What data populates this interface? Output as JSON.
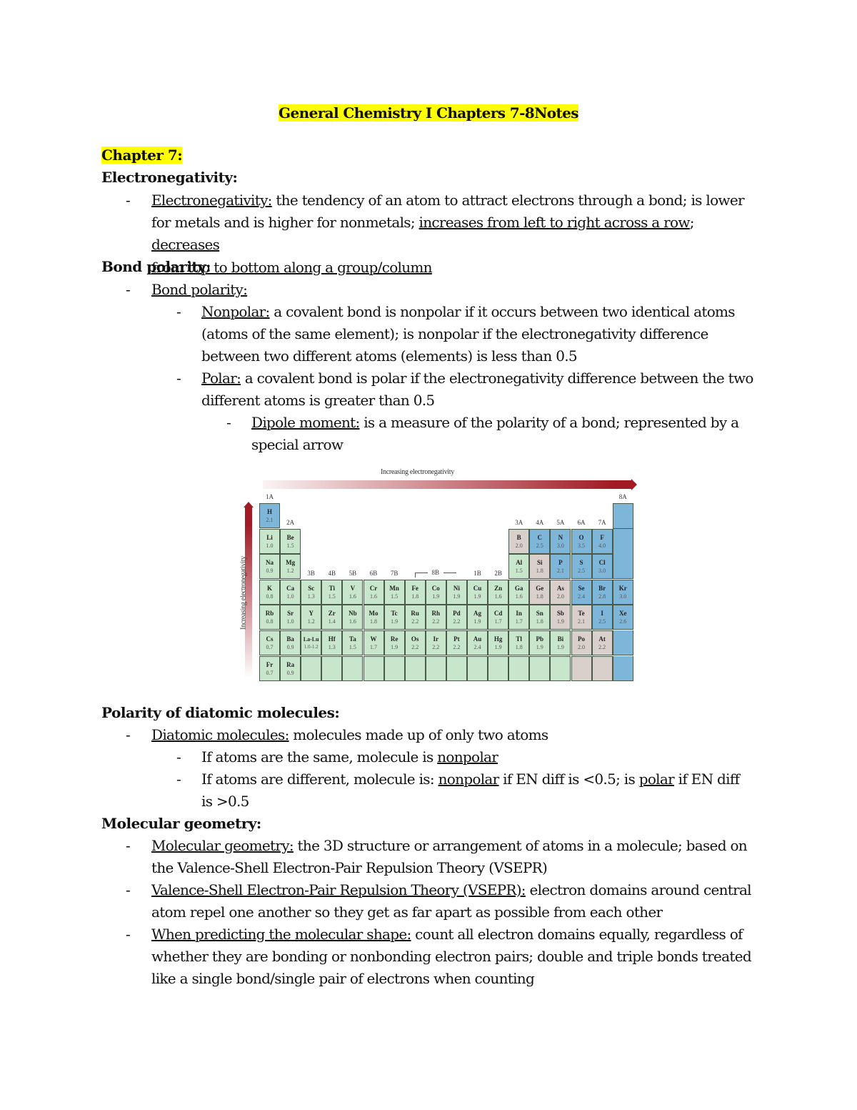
{
  "title": "General Chemistry I Chapters 7-8Notes",
  "chapter_heading": "Chapter 7:",
  "sections": {
    "electronegativity": {
      "heading": "Electronegativity:",
      "term": "Electronegativity:",
      "text_1": " the tendency of an atom to attract electrons through a bond; is lower",
      "text_2a": "for metals and is higher for nonmetals; ",
      "text_2b": "increases from left to right across a row",
      "text_2c": "; ",
      "text_2d": "decreases",
      "text_3": "from top to bottom along a group/column"
    },
    "bond_polarity": {
      "heading": "Bond polarity:",
      "term": "Bond polarity:",
      "nonpolar_term": "Nonpolar:",
      "nonpolar_1": " a covalent bond is nonpolar if it occurs between two identical atoms",
      "nonpolar_2": "(atoms of the same element); is nonpolar if the electronegativity difference",
      "nonpolar_3": "between two different atoms (elements) is less than 0.5",
      "polar_term": "Polar:",
      "polar_1": " a covalent bond is polar if the electronegativity difference between the two",
      "polar_2": "different atoms is greater than 0.5",
      "dipole_term": "Dipole moment:",
      "dipole_1": " is a measure of the polarity of a bond; represented by a",
      "dipole_2": "special arrow"
    },
    "diatomic": {
      "heading": "Polarity of diatomic molecules:",
      "term": "Diatomic molecules:",
      "text_1": " molecules made up of only two atoms",
      "same_a": "If atoms are the same, molecule is ",
      "same_b": "nonpolar",
      "diff_a": "If atoms are different, molecule is: ",
      "diff_b": "nonpolar",
      "diff_c": " if EN diff is <0.5; is ",
      "diff_d": "polar",
      "diff_e": " if EN diff",
      "diff_2": "is >0.5"
    },
    "geometry": {
      "heading": "Molecular geometry:",
      "term1": "Molecular geometry:",
      "t1_1": " the 3D structure or arrangement of atoms in a molecule; based on",
      "t1_2": "the Valence-Shell Electron-Pair Repulsion Theory (VSEPR)",
      "term2": "Valence-Shell Electron-Pair Repulsion Theory (VSEPR):",
      "t2_1": " electron domains around central",
      "t2_2": "atom repel one another so they get as far apart as possible from each other",
      "term3": "When predicting the molecular shape:",
      "t3_1": " count all electron domains equally, regardless of",
      "t3_2": "whether they are bonding or nonbonding electron pairs; double and triple bonds treated",
      "t3_3": "like a single bond/single pair of electrons when counting"
    }
  },
  "bullet_glyph": "-",
  "figure": {
    "top_label": "Increasing electronegativity",
    "side_label": "Increasing electronegativity",
    "groups": [
      "1A",
      "2A",
      "3B",
      "4B",
      "5B",
      "6B",
      "7B",
      "8B",
      "1B",
      "2B",
      "3A",
      "4A",
      "5A",
      "6A",
      "7A",
      "8A"
    ],
    "colors": {
      "metal": "#c8e6cc",
      "metalloid": "#d9cfcb",
      "nonmetal": "#7eb6da",
      "arrow": "#a11a24"
    },
    "elements": [
      {
        "sym": "H",
        "en": "2.1",
        "col": 0,
        "row": 0,
        "type": "nonmetal"
      },
      {
        "sym": "Li",
        "en": "1.0",
        "col": 0,
        "row": 1,
        "type": "metal"
      },
      {
        "sym": "Be",
        "en": "1.5",
        "col": 1,
        "row": 1,
        "type": "metal"
      },
      {
        "sym": "B",
        "en": "2.0",
        "col": 12,
        "row": 1,
        "type": "metalloid"
      },
      {
        "sym": "C",
        "en": "2.5",
        "col": 13,
        "row": 1,
        "type": "nonmetal"
      },
      {
        "sym": "N",
        "en": "3.0",
        "col": 14,
        "row": 1,
        "type": "nonmetal"
      },
      {
        "sym": "O",
        "en": "3.5",
        "col": 15,
        "row": 1,
        "type": "nonmetal"
      },
      {
        "sym": "F",
        "en": "4.0",
        "col": 16,
        "row": 1,
        "type": "nonmetal"
      },
      {
        "sym": "Na",
        "en": "0.9",
        "col": 0,
        "row": 2,
        "type": "metal"
      },
      {
        "sym": "Mg",
        "en": "1.2",
        "col": 1,
        "row": 2,
        "type": "metal"
      },
      {
        "sym": "Al",
        "en": "1.5",
        "col": 12,
        "row": 2,
        "type": "metal"
      },
      {
        "sym": "Si",
        "en": "1.8",
        "col": 13,
        "row": 2,
        "type": "metalloid"
      },
      {
        "sym": "P",
        "en": "2.1",
        "col": 14,
        "row": 2,
        "type": "nonmetal"
      },
      {
        "sym": "S",
        "en": "2.5",
        "col": 15,
        "row": 2,
        "type": "nonmetal"
      },
      {
        "sym": "Cl",
        "en": "3.0",
        "col": 16,
        "row": 2,
        "type": "nonmetal"
      },
      {
        "sym": "K",
        "en": "0.8",
        "col": 0,
        "row": 3,
        "type": "metal"
      },
      {
        "sym": "Ca",
        "en": "1.0",
        "col": 1,
        "row": 3,
        "type": "metal"
      },
      {
        "sym": "Sc",
        "en": "1.3",
        "col": 2,
        "row": 3,
        "type": "metal"
      },
      {
        "sym": "Ti",
        "en": "1.5",
        "col": 3,
        "row": 3,
        "type": "metal"
      },
      {
        "sym": "V",
        "en": "1.6",
        "col": 4,
        "row": 3,
        "type": "metal"
      },
      {
        "sym": "Cr",
        "en": "1.6",
        "col": 5,
        "row": 3,
        "type": "metal"
      },
      {
        "sym": "Mn",
        "en": "1.5",
        "col": 6,
        "row": 3,
        "type": "metal"
      },
      {
        "sym": "Fe",
        "en": "1.8",
        "col": 7,
        "row": 3,
        "type": "metal"
      },
      {
        "sym": "Co",
        "en": "1.9",
        "col": 8,
        "row": 3,
        "type": "metal"
      },
      {
        "sym": "Ni",
        "en": "1.9",
        "col": 9,
        "row": 3,
        "type": "metal"
      },
      {
        "sym": "Cu",
        "en": "1.9",
        "col": 10,
        "row": 3,
        "type": "metal"
      },
      {
        "sym": "Zn",
        "en": "1.6",
        "col": 11,
        "row": 3,
        "type": "metal"
      },
      {
        "sym": "Ga",
        "en": "1.6",
        "col": 12,
        "row": 3,
        "type": "metal"
      },
      {
        "sym": "Ge",
        "en": "1.8",
        "col": 13,
        "row": 3,
        "type": "metalloid"
      },
      {
        "sym": "As",
        "en": "2.0",
        "col": 14,
        "row": 3,
        "type": "metalloid"
      },
      {
        "sym": "Se",
        "en": "2.4",
        "col": 15,
        "row": 3,
        "type": "nonmetal"
      },
      {
        "sym": "Br",
        "en": "2.8",
        "col": 16,
        "row": 3,
        "type": "nonmetal"
      },
      {
        "sym": "Kr",
        "en": "3.0",
        "col": 17,
        "row": 3,
        "type": "nonmetal"
      },
      {
        "sym": "Rb",
        "en": "0.8",
        "col": 0,
        "row": 4,
        "type": "metal"
      },
      {
        "sym": "Sr",
        "en": "1.0",
        "col": 1,
        "row": 4,
        "type": "metal"
      },
      {
        "sym": "Y",
        "en": "1.2",
        "col": 2,
        "row": 4,
        "type": "metal"
      },
      {
        "sym": "Zr",
        "en": "1.4",
        "col": 3,
        "row": 4,
        "type": "metal"
      },
      {
        "sym": "Nb",
        "en": "1.6",
        "col": 4,
        "row": 4,
        "type": "metal"
      },
      {
        "sym": "Mo",
        "en": "1.8",
        "col": 5,
        "row": 4,
        "type": "metal"
      },
      {
        "sym": "Tc",
        "en": "1.9",
        "col": 6,
        "row": 4,
        "type": "metal"
      },
      {
        "sym": "Ru",
        "en": "2.2",
        "col": 7,
        "row": 4,
        "type": "metal"
      },
      {
        "sym": "Rh",
        "en": "2.2",
        "col": 8,
        "row": 4,
        "type": "metal"
      },
      {
        "sym": "Pd",
        "en": "2.2",
        "col": 9,
        "row": 4,
        "type": "metal"
      },
      {
        "sym": "Ag",
        "en": "1.9",
        "col": 10,
        "row": 4,
        "type": "metal"
      },
      {
        "sym": "Cd",
        "en": "1.7",
        "col": 11,
        "row": 4,
        "type": "metal"
      },
      {
        "sym": "In",
        "en": "1.7",
        "col": 12,
        "row": 4,
        "type": "metal"
      },
      {
        "sym": "Sn",
        "en": "1.8",
        "col": 13,
        "row": 4,
        "type": "metal"
      },
      {
        "sym": "Sb",
        "en": "1.9",
        "col": 14,
        "row": 4,
        "type": "metalloid"
      },
      {
        "sym": "Te",
        "en": "2.1",
        "col": 15,
        "row": 4,
        "type": "metalloid"
      },
      {
        "sym": "I",
        "en": "2.5",
        "col": 16,
        "row": 4,
        "type": "nonmetal"
      },
      {
        "sym": "Xe",
        "en": "2.6",
        "col": 17,
        "row": 4,
        "type": "nonmetal"
      },
      {
        "sym": "Cs",
        "en": "0.7",
        "col": 0,
        "row": 5,
        "type": "metal"
      },
      {
        "sym": "Ba",
        "en": "0.9",
        "col": 1,
        "row": 5,
        "type": "metal"
      },
      {
        "sym": "La-Lu",
        "en": "1.0-1.2",
        "col": 2,
        "row": 5,
        "type": "metal"
      },
      {
        "sym": "Hf",
        "en": "1.3",
        "col": 3,
        "row": 5,
        "type": "metal"
      },
      {
        "sym": "Ta",
        "en": "1.5",
        "col": 4,
        "row": 5,
        "type": "metal"
      },
      {
        "sym": "W",
        "en": "1.7",
        "col": 5,
        "row": 5,
        "type": "metal"
      },
      {
        "sym": "Re",
        "en": "1.9",
        "col": 6,
        "row": 5,
        "type": "metal"
      },
      {
        "sym": "Os",
        "en": "2.2",
        "col": 7,
        "row": 5,
        "type": "metal"
      },
      {
        "sym": "Ir",
        "en": "2.2",
        "col": 8,
        "row": 5,
        "type": "metal"
      },
      {
        "sym": "Pt",
        "en": "2.2",
        "col": 9,
        "row": 5,
        "type": "metal"
      },
      {
        "sym": "Au",
        "en": "2.4",
        "col": 10,
        "row": 5,
        "type": "metal"
      },
      {
        "sym": "Hg",
        "en": "1.9",
        "col": 11,
        "row": 5,
        "type": "metal"
      },
      {
        "sym": "Tl",
        "en": "1.8",
        "col": 12,
        "row": 5,
        "type": "metal"
      },
      {
        "sym": "Pb",
        "en": "1.9",
        "col": 13,
        "row": 5,
        "type": "metal"
      },
      {
        "sym": "Bi",
        "en": "1.9",
        "col": 14,
        "row": 5,
        "type": "metal"
      },
      {
        "sym": "Po",
        "en": "2.0",
        "col": 15,
        "row": 5,
        "type": "metalloid"
      },
      {
        "sym": "At",
        "en": "2.2",
        "col": 16,
        "row": 5,
        "type": "metalloid"
      },
      {
        "sym": "Fr",
        "en": "0.7",
        "col": 0,
        "row": 6,
        "type": "metal"
      },
      {
        "sym": "Ra",
        "en": "0.9",
        "col": 1,
        "row": 6,
        "type": "metal"
      }
    ]
  }
}
